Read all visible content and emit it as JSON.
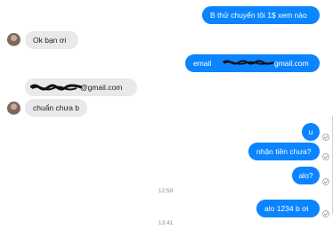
{
  "messages": {
    "m1": "B thử chuyển tôi 1$ xem nào",
    "m2": "Ok bạn ơi",
    "m3_prefix": "email",
    "m3_suffix": "gmail.com",
    "m4_suffix": "@gmail.com",
    "m5": "chuẩn chưa b",
    "m6": "u",
    "m7": "nhận tiền chưa?",
    "m8": "alo?",
    "m9": "alo 1234 b ơi"
  },
  "timestamps": {
    "t1": "12:59",
    "t2": "13:41"
  },
  "colors": {
    "outgoing": "#0a84ff",
    "incoming": "#e9e9eb",
    "redaction": "#111111"
  }
}
